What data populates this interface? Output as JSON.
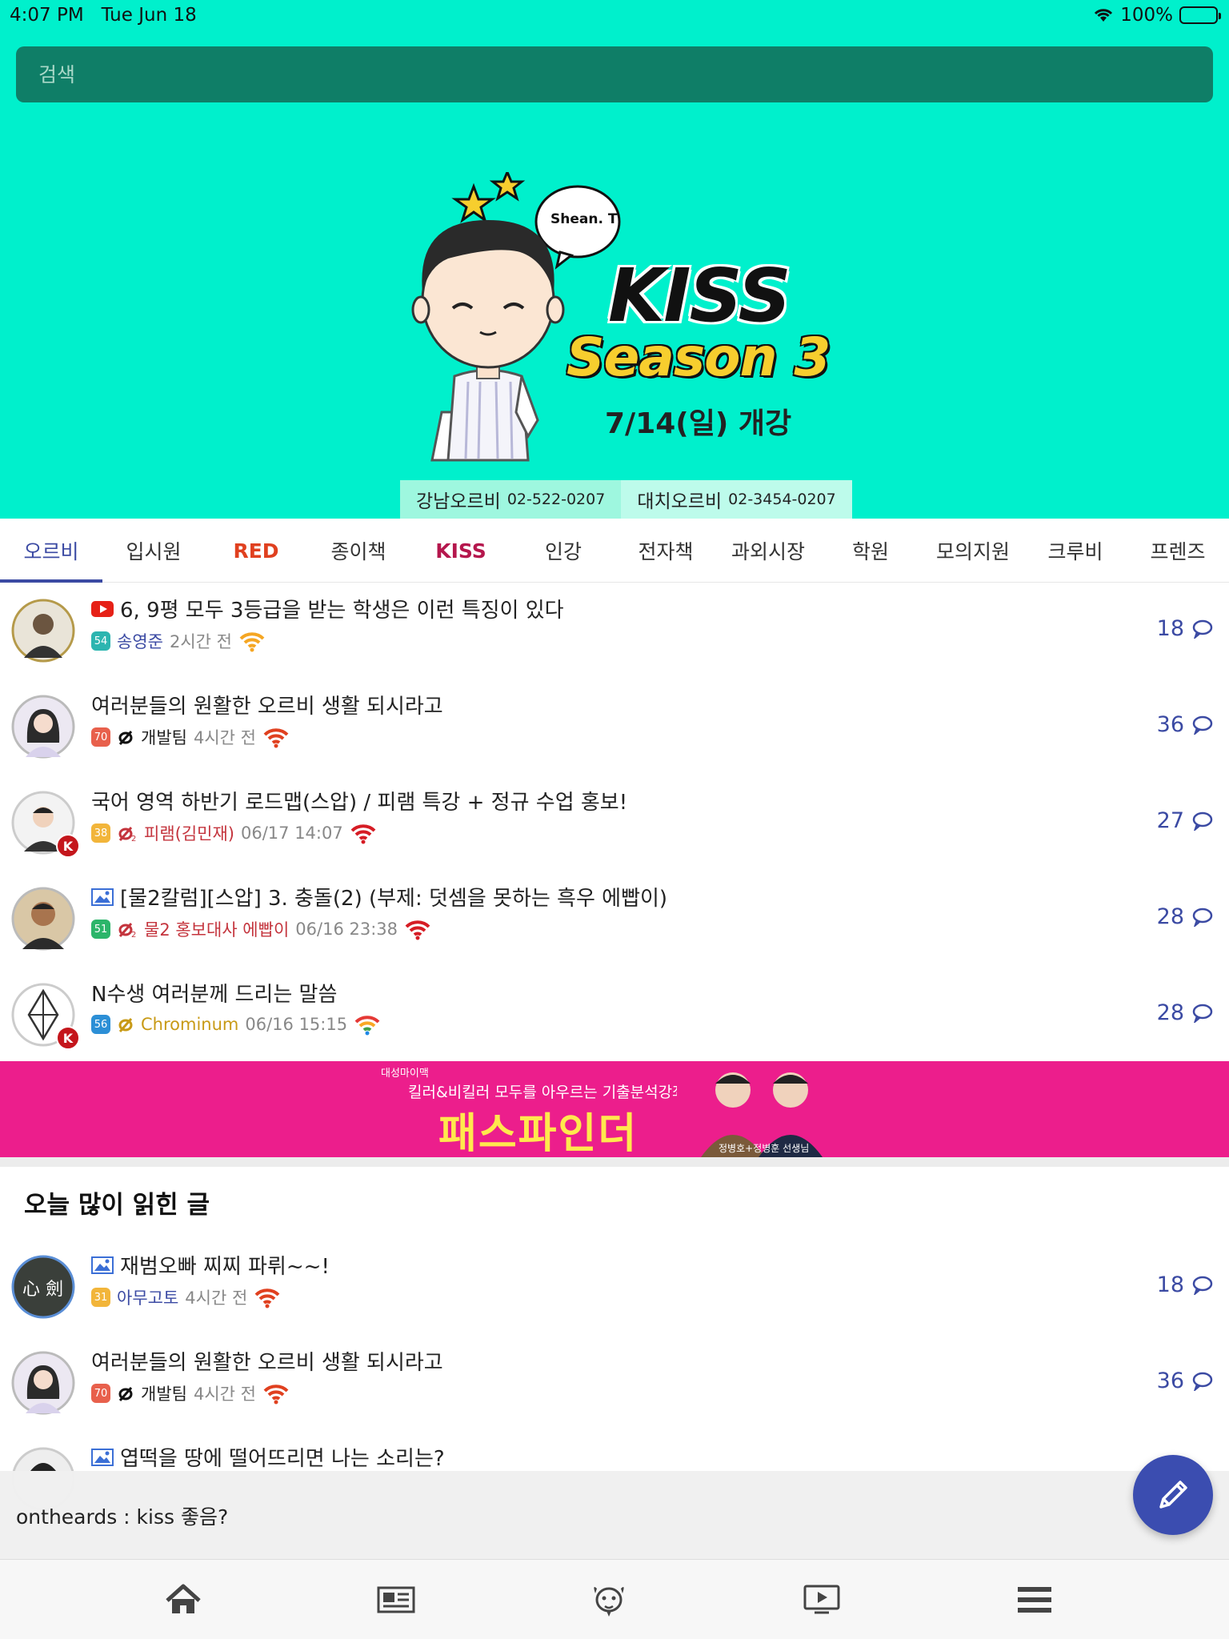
{
  "status": {
    "time": "4:07 PM",
    "date": "Tue Jun 18",
    "battery": "100%"
  },
  "search": {
    "placeholder": "검색"
  },
  "banner": {
    "speech": "Shean. T",
    "title": "KISS",
    "subtitle": "Season 3",
    "date": "7/14(일) 개강",
    "phones": [
      {
        "name": "강남오르비",
        "number": "02-522-0207"
      },
      {
        "name": "대치오르비",
        "number": "02-3454-0207"
      }
    ]
  },
  "tabs": [
    "오르비",
    "입시원",
    "RED",
    "종이책",
    "KISS",
    "인강",
    "전자책",
    "과외시장",
    "학원",
    "모의지원",
    "크루비",
    "프렌즈"
  ],
  "posts": [
    {
      "icon": "youtube-icon",
      "title": "6, 9평 모두 3등급을 받는 학생은 이런 특징이 있다",
      "level": "54",
      "level_color": "#2CB5B0",
      "author": "송영준",
      "time": "2시간 전",
      "count": "18",
      "author_color": "#3B4AA3"
    },
    {
      "icon": "",
      "title": "여러분들의 원활한 오르비 생활 되시라고",
      "level": "70",
      "level_color": "#E8604C",
      "author": "개발팀",
      "time": "4시간 전",
      "count": "36",
      "author_color": "#222"
    },
    {
      "icon": "",
      "title": "국어 영역 하반기 로드맵(스압) / 피램 특강 + 정규 수업 홍보!",
      "level": "38",
      "level_color": "#F2B53A",
      "author": "피램(김민재)",
      "time": "06/17 14:07",
      "count": "27",
      "author_color": "#C4343D"
    },
    {
      "icon": "image-icon",
      "title": "[물2칼럼][스압] 3. 충돌(2) (부제: 덧셈을 못하는 흑우 에빱이)",
      "level": "51",
      "level_color": "#2CB56A",
      "author": "물2 홍보대사 에빱이",
      "time": "06/16 23:38",
      "count": "28",
      "author_color": "#C4343D"
    },
    {
      "icon": "",
      "title": "N수생 여러분께 드리는 말씀",
      "level": "56",
      "level_color": "#2C8FD6",
      "author": "Chrominum",
      "time": "06/16 15:15",
      "count": "28",
      "author_color": "#C89A16"
    }
  ],
  "ad": {
    "brand": "대성마이맥",
    "subtitle": "킬러&비킬러 모두를 아우르는 기출분석강좌",
    "title": "패스파인더",
    "caption": "정병호+정병훈 선생님"
  },
  "popular": {
    "section_title": "오늘 많이 읽힌 글",
    "posts": [
      {
        "icon": "image-icon",
        "title": "재범오빠 찌찌 파뤼~~!",
        "level": "31",
        "level_color": "#F2B53A",
        "author": "아무고토",
        "time": "4시간 전",
        "count": "18",
        "author_color": "#3B4AA3"
      },
      {
        "icon": "",
        "title": "여러분들의 원활한 오르비 생활 되시라고",
        "level": "70",
        "level_color": "#E8604C",
        "author": "개발팀",
        "time": "4시간 전",
        "count": "36",
        "author_color": "#222"
      },
      {
        "icon": "image-icon",
        "title": "엽떡을 땅에 떨어뜨리면 나는 소리는?",
        "level": "",
        "level_color": "",
        "author": "",
        "time": "",
        "count": "",
        "author_color": ""
      }
    ]
  },
  "toast": {
    "text": "ontheards : kiss 좋음?"
  },
  "colors": {
    "header": "#00F0CC",
    "accent": "#3B4AA3",
    "ad": "#EC1E8C",
    "fab": "#3B4DB0"
  }
}
